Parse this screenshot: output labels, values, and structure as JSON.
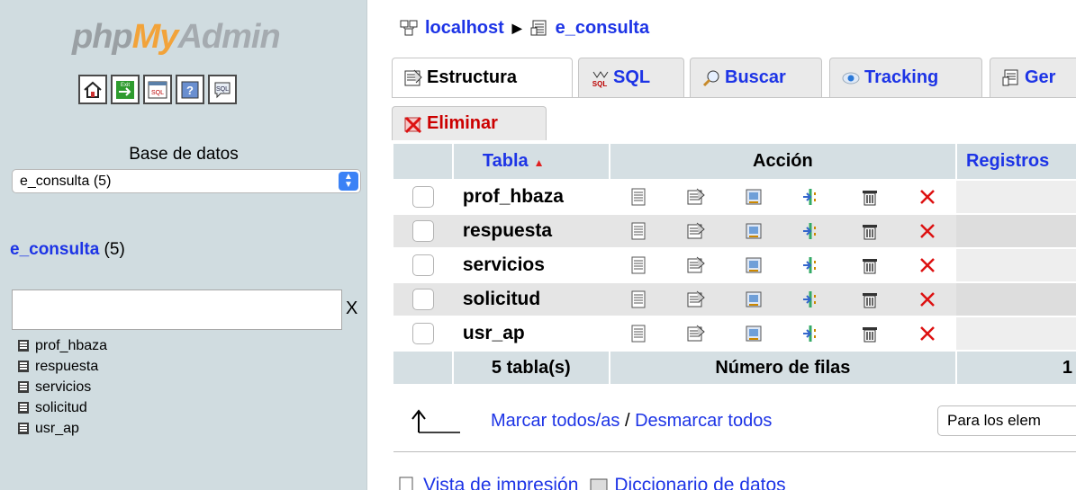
{
  "logo": {
    "php": "php",
    "my": "My",
    "admin": "Admin"
  },
  "nav": {
    "quick_icons": [
      "home-icon",
      "exit-icon",
      "sql-query-icon",
      "help-icon",
      "sql-docs-icon"
    ],
    "db_label": "Base de datos",
    "db_select_value": "e_consulta (5)",
    "db_name": "e_consulta",
    "db_count": "(5)",
    "filter_value": "",
    "filter_clear": "X",
    "tables": [
      "prof_hbaza",
      "respuesta",
      "servicios",
      "solicitud",
      "usr_ap"
    ]
  },
  "breadcrumb": {
    "server": "localhost",
    "database": "e_consulta"
  },
  "tabs": {
    "structure": "Estructura",
    "sql": "SQL",
    "search": "Buscar",
    "tracking": "Tracking",
    "generate": "Ger",
    "drop": "Eliminar"
  },
  "table": {
    "col_table": "Tabla",
    "col_action": "Acción",
    "col_records": "Registros",
    "rows": [
      {
        "name": "prof_hbaza"
      },
      {
        "name": "respuesta"
      },
      {
        "name": "servicios"
      },
      {
        "name": "solicitud"
      },
      {
        "name": "usr_ap"
      }
    ],
    "footer_count": "5 tabla(s)",
    "footer_label": "Número de filas",
    "footer_total": "1"
  },
  "bulk": {
    "check_all": "Marcar todos/as",
    "separator": " / ",
    "uncheck_all": "Desmarcar todos",
    "with_selected": "Para los elem"
  },
  "footer": {
    "print_view": "Vista de impresión",
    "dictionary": "Diccionario de datos"
  },
  "colors": {
    "link": "#1d34e6",
    "nav_bg": "#d0dce0",
    "header_bg": "#d5dfe3",
    "drop": "#cc0000"
  }
}
